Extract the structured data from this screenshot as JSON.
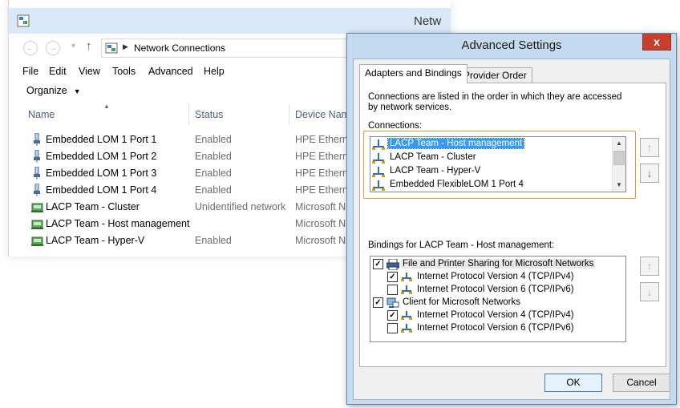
{
  "explorer": {
    "title": "Netw",
    "address": {
      "path": "Network Connections"
    },
    "menu": [
      "File",
      "Edit",
      "View",
      "Tools",
      "Advanced",
      "Help"
    ],
    "organize_label": "Organize",
    "columns": {
      "name": "Name",
      "status": "Status",
      "device": "Device Nam"
    },
    "connections": [
      {
        "name": "Embedded LOM 1 Port 1",
        "status": "Enabled",
        "device": "HPE Etherne",
        "icon": "network-adapter-icon"
      },
      {
        "name": "Embedded LOM 1 Port 2",
        "status": "Enabled",
        "device": "HPE Etherne",
        "icon": "network-adapter-icon"
      },
      {
        "name": "Embedded LOM 1 Port 3",
        "status": "Enabled",
        "device": "HPE Etherne",
        "icon": "network-adapter-icon"
      },
      {
        "name": "Embedded LOM 1 Port 4",
        "status": "Enabled",
        "device": "HPE Etherne",
        "icon": "network-adapter-icon"
      },
      {
        "name": "LACP Team - Cluster",
        "status": "Unidentified network",
        "device": "Microsoft N",
        "icon": "network-team-icon"
      },
      {
        "name": "LACP Team - Host management",
        "status": "",
        "device": "Microsoft N",
        "icon": "network-team-icon"
      },
      {
        "name": "LACP Team - Hyper-V",
        "status": "Enabled",
        "device": "Microsoft N",
        "icon": "network-team-icon"
      }
    ]
  },
  "dialog": {
    "title": "Advanced Settings",
    "close_label": "x",
    "tabs": [
      {
        "label": "Adapters and Bindings",
        "active": true
      },
      {
        "label": "Provider Order",
        "active": false
      }
    ],
    "intro": "Connections are listed in the order in which they are accessed by network services.",
    "connections_label": "Connections:",
    "connections": [
      {
        "label": "LACP Team - Host management",
        "selected": true
      },
      {
        "label": "LACP Team - Cluster",
        "selected": false
      },
      {
        "label": "LACP Team - Hyper-V",
        "selected": false
      },
      {
        "label": "Embedded FlexibleLOM 1 Port 4",
        "selected": false
      }
    ],
    "bindings_label": "Bindings for LACP Team - Host management:",
    "bindings": [
      {
        "label": "File and Printer Sharing for Microsoft Networks",
        "checked": true,
        "level": 0,
        "icon": "printer-share-icon",
        "highlight": true
      },
      {
        "label": "Internet Protocol Version 4 (TCP/IPv4)",
        "checked": true,
        "level": 1,
        "icon": "protocol-icon",
        "highlight": false
      },
      {
        "label": "Internet Protocol Version 6 (TCP/IPv6)",
        "checked": false,
        "level": 1,
        "icon": "protocol-icon",
        "highlight": false
      },
      {
        "label": "Client for Microsoft Networks",
        "checked": true,
        "level": 0,
        "icon": "network-client-icon",
        "highlight": false
      },
      {
        "label": "Internet Protocol Version 4 (TCP/IPv4)",
        "checked": true,
        "level": 1,
        "icon": "protocol-icon",
        "highlight": false
      },
      {
        "label": "Internet Protocol Version 6 (TCP/IPv6)",
        "checked": false,
        "level": 1,
        "icon": "protocol-icon",
        "highlight": false
      }
    ],
    "ok_label": "OK",
    "cancel_label": "Cancel",
    "colors": {
      "selection": "#3399ff",
      "highlight_frame": "#f0932e",
      "close": "#c7402f"
    }
  }
}
